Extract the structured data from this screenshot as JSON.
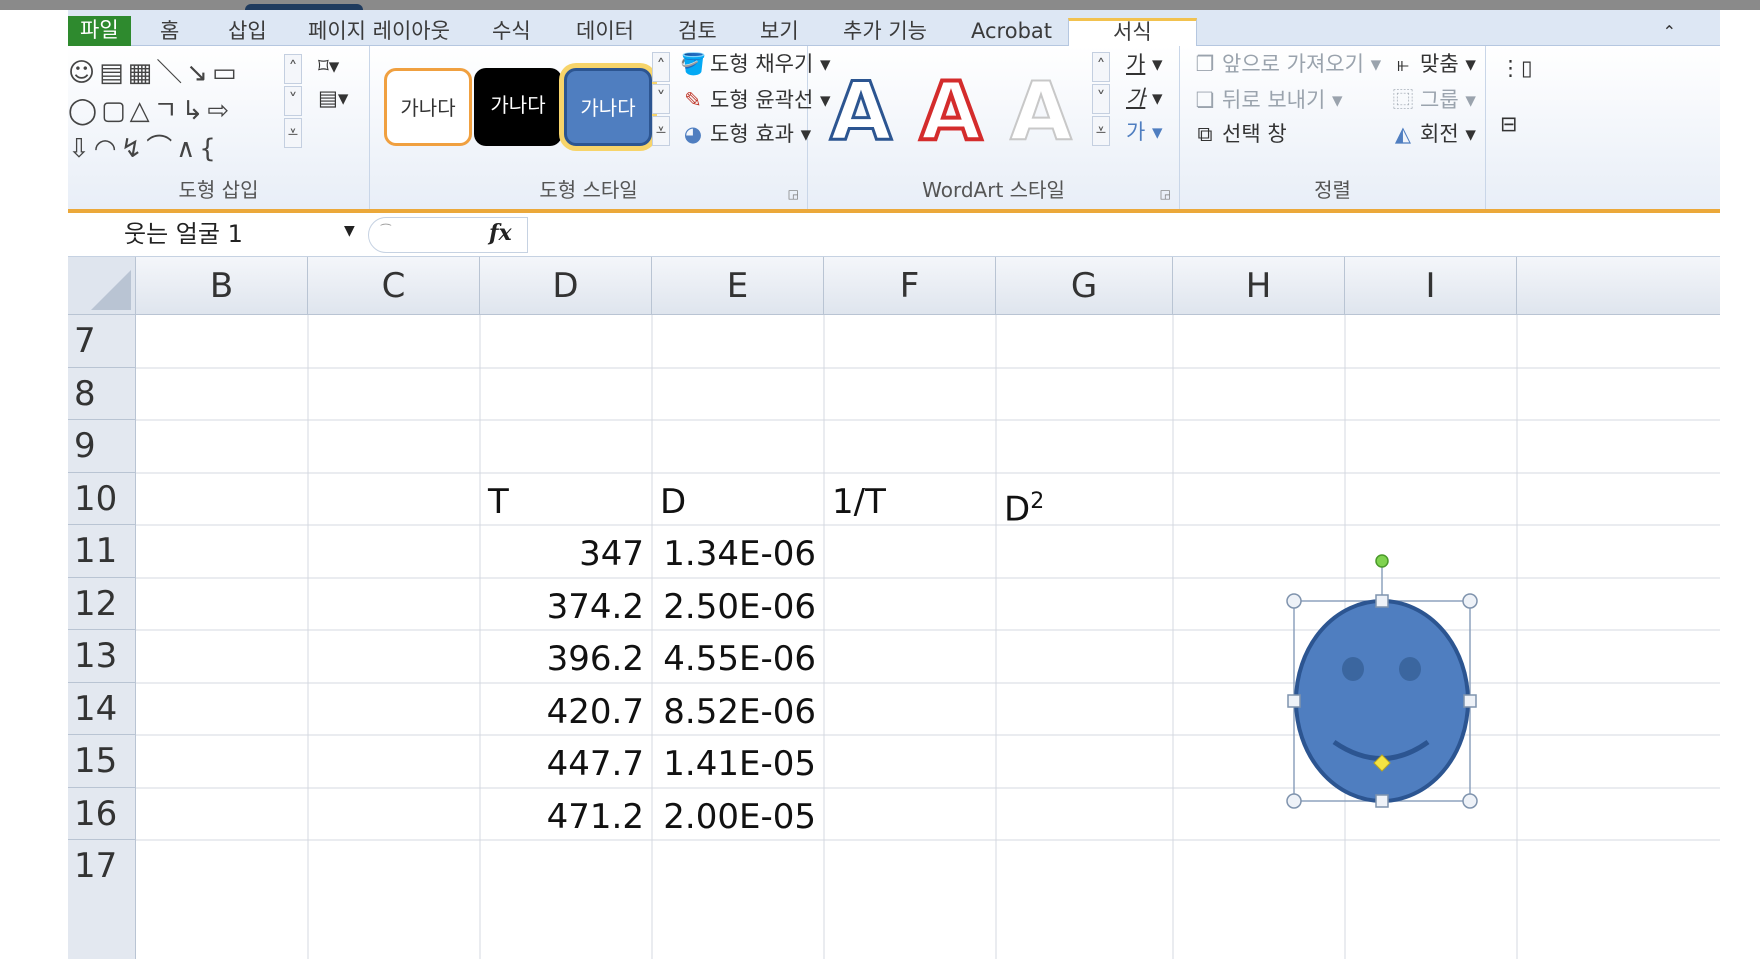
{
  "tabs": {
    "file": "파일",
    "items": [
      "홈",
      "삽입",
      "페이지 레이아웃",
      "수식",
      "데이터",
      "검토",
      "보기",
      "추가 기능",
      "Acrobat"
    ],
    "active": "서식"
  },
  "ribbon": {
    "groups": {
      "insert_shapes": "도형 삽입",
      "shape_styles": "도형 스타일",
      "wordart_styles": "WordArt 스타일",
      "arrange": "정렬"
    },
    "shape_style_samples": [
      "가나다",
      "가나다",
      "가나다"
    ],
    "shape_commands": {
      "fill": "도형 채우기",
      "outline": "도형 윤곽선",
      "effects": "도형 효과"
    },
    "wordart_letter": "A",
    "wordart_commands": {
      "text_fill": "가",
      "text_outline": "가",
      "text_effects": "가"
    },
    "arrange_commands": {
      "bring_forward": "앞으로 가져오기",
      "send_backward": "뒤로 보내기",
      "selection_pane": "선택 창",
      "align": "맞춤",
      "group": "그룹",
      "rotate": "회전"
    },
    "accent_color": "#eba83a"
  },
  "formula_bar": {
    "name_box": "웃는 얼굴 1",
    "fx": "fx",
    "formula": ""
  },
  "sheet": {
    "columns": [
      "B",
      "C",
      "D",
      "E",
      "F",
      "G",
      "H",
      "I"
    ],
    "rows": [
      "7",
      "8",
      "9",
      "10",
      "11",
      "12",
      "13",
      "14",
      "15",
      "16",
      "17"
    ],
    "headers": {
      "T": "T",
      "D": "D",
      "invT": "1/T",
      "D2_base": "D",
      "D2_exp": "2"
    },
    "data": [
      {
        "T": "347",
        "D": "1.34E-06"
      },
      {
        "T": "374.2",
        "D": "2.50E-06"
      },
      {
        "T": "396.2",
        "D": "4.55E-06"
      },
      {
        "T": "420.7",
        "D": "8.52E-06"
      },
      {
        "T": "447.7",
        "D": "1.41E-05"
      },
      {
        "T": "471.2",
        "D": "2.00E-05"
      }
    ]
  },
  "shape": {
    "name": "웃는 얼굴 1",
    "fill_color": "#4f7ec0",
    "outline_color": "#2c5591"
  }
}
